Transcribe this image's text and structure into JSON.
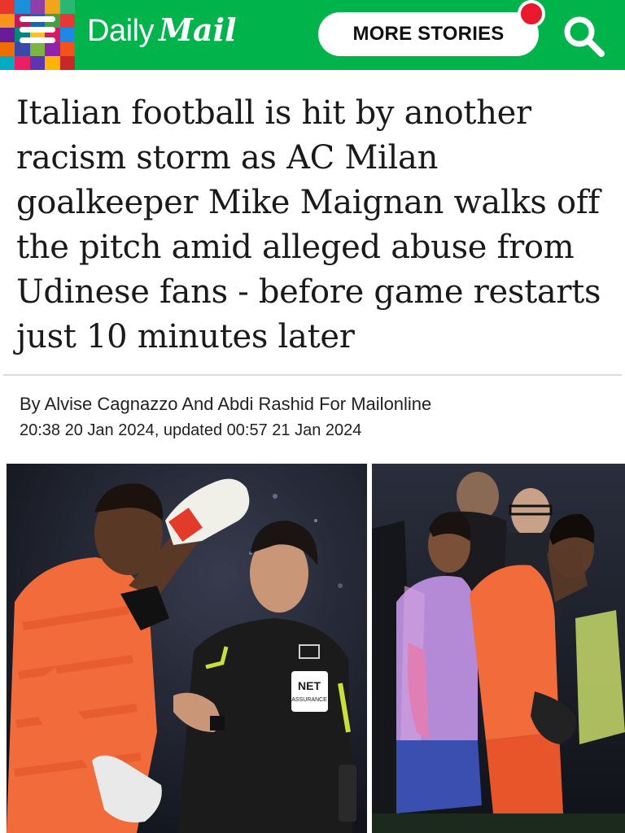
{
  "header": {
    "brand_daily": "Daily",
    "brand_mail": "Mail",
    "more_stories_label": "MORE STORIES",
    "icons": {
      "menu": "menu-icon",
      "search": "search-icon",
      "notification": "notification-dot"
    },
    "colors": {
      "background": "#00b34a",
      "notification": "#e8192c"
    }
  },
  "article": {
    "headline": "Italian football is hit by another racism storm as AC Milan goalkeeper Mike Maignan walks off the pitch amid alleged abuse from Udinese fans - before game restarts just 10 minutes later",
    "byline": "By Alvise Cagnazzo And Abdi Rashid For Mailonline",
    "dateline": "20:38 20 Jan 2024, updated 00:57 21 Jan 2024"
  },
  "photos": {
    "left_badge": "NET",
    "left_badge_sub": "ASSURANCE"
  }
}
